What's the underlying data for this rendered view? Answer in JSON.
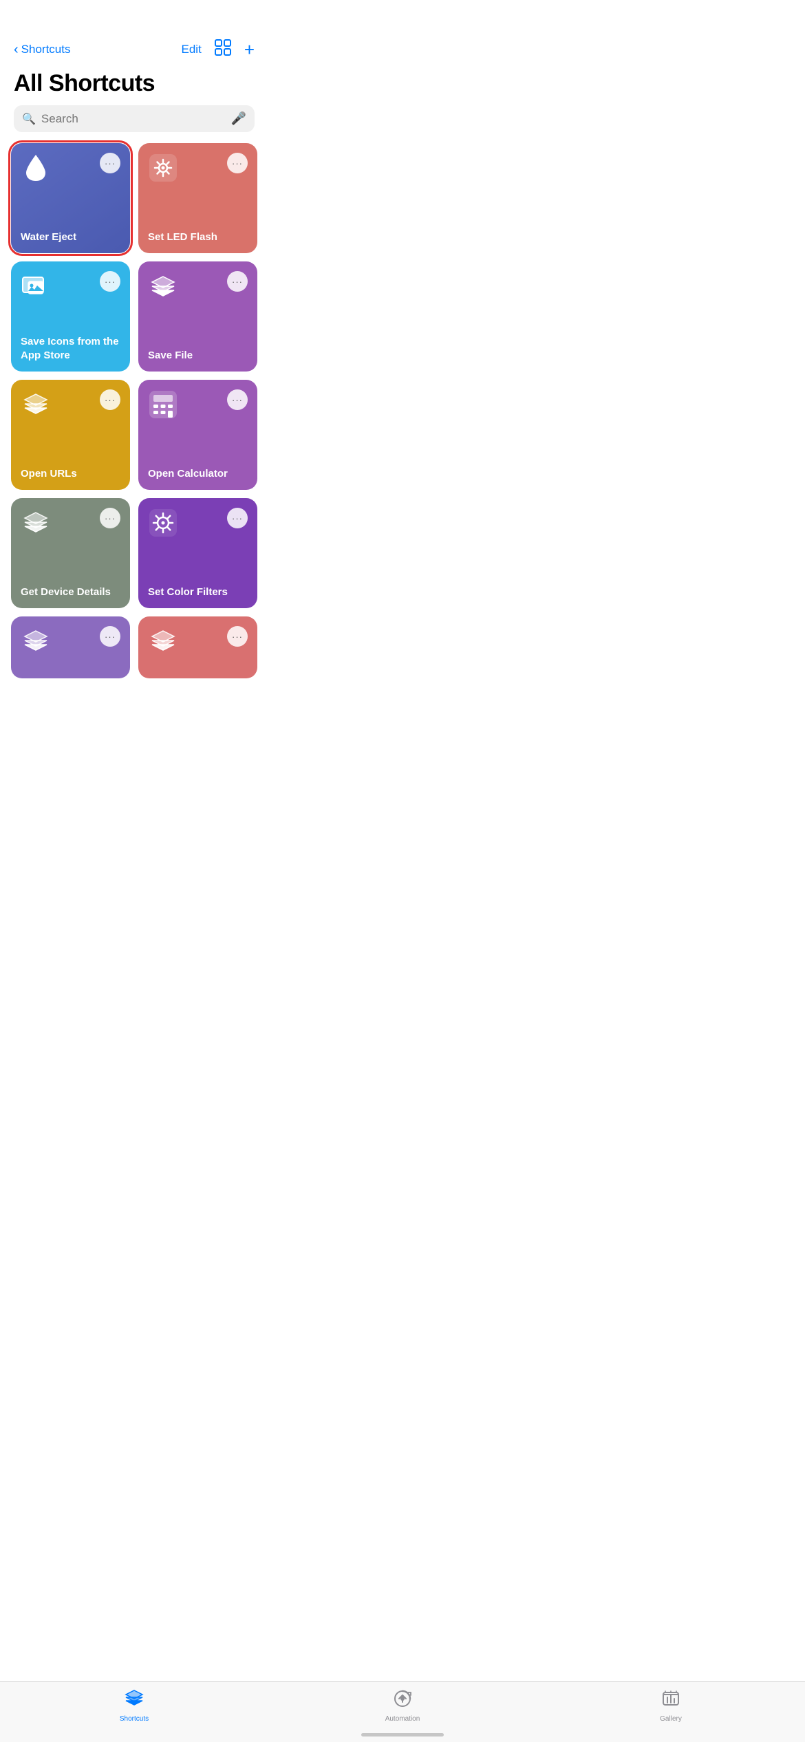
{
  "nav": {
    "back_label": "Shortcuts",
    "edit_label": "Edit",
    "add_label": "+"
  },
  "page": {
    "title": "All Shortcuts"
  },
  "search": {
    "placeholder": "Search"
  },
  "shortcuts": [
    {
      "id": "water-eject",
      "label": "Water Eject",
      "color": "water-eject",
      "icon_type": "water",
      "selected": true
    },
    {
      "id": "set-led-flash",
      "label": "Set LED Flash",
      "color": "set-led-flash",
      "icon_type": "settings",
      "selected": false
    },
    {
      "id": "save-icons",
      "label": "Save Icons from the App Store",
      "color": "save-icons",
      "icon_type": "photos",
      "selected": false
    },
    {
      "id": "save-file",
      "label": "Save File",
      "color": "save-file",
      "icon_type": "layers",
      "selected": false
    },
    {
      "id": "open-urls",
      "label": "Open URLs",
      "color": "open-urls",
      "icon_type": "layers",
      "selected": false
    },
    {
      "id": "open-calculator",
      "label": "Open Calculator",
      "color": "open-calculator",
      "icon_type": "calculator",
      "selected": false
    },
    {
      "id": "get-device",
      "label": "Get Device Details",
      "color": "get-device",
      "icon_type": "layers",
      "selected": false
    },
    {
      "id": "set-color",
      "label": "Set Color Filters",
      "color": "set-color",
      "icon_type": "settings2",
      "selected": false
    },
    {
      "id": "partial-left",
      "label": "",
      "color": "partial-left",
      "icon_type": "layers",
      "selected": false,
      "partial": true
    },
    {
      "id": "partial-right",
      "label": "",
      "color": "partial-right",
      "icon_type": "layers",
      "selected": false,
      "partial": true
    }
  ],
  "tabs": [
    {
      "id": "shortcuts",
      "label": "Shortcuts",
      "active": true
    },
    {
      "id": "automation",
      "label": "Automation",
      "active": false
    },
    {
      "id": "gallery",
      "label": "Gallery",
      "active": false
    }
  ],
  "more_button_label": "···"
}
